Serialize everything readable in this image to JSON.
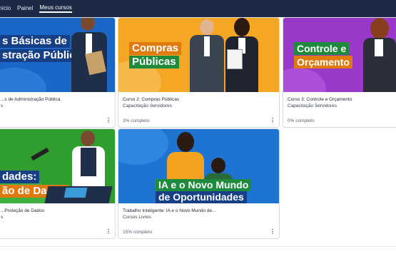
{
  "nav": {
    "items": [
      {
        "label": "Início",
        "active": false
      },
      {
        "label": "Painel",
        "active": false
      },
      {
        "label": "Meus cursos",
        "active": true
      }
    ]
  },
  "courses": [
    {
      "banner_lines": [
        "s Básicas de",
        "stração Pública"
      ],
      "title": "...s de Administração Pública",
      "category": "s",
      "progress": "",
      "color": "#1b67c8"
    },
    {
      "banner_lines": [
        "Compras",
        "Públicas"
      ],
      "title": "Curso 2: Compras Públicas",
      "category": "Capacitação Servidores",
      "progress": "3% completo",
      "color": "#f5a623"
    },
    {
      "banner_lines": [
        "Controle e",
        "Orçamento"
      ],
      "title": "Curso 3: Controle e Orçamento",
      "category": "Capacitação Servidores",
      "progress": "0% completo",
      "color": "#9a38c9"
    },
    {
      "banner_lines": [
        "dades:",
        "ão de Dados"
      ],
      "title": "...Proteção de Dados",
      "category": "s",
      "progress": "",
      "color": "#2f9e2f"
    },
    {
      "banner_lines": [
        "IA e o Novo Mundo",
        "de Oportunidades"
      ],
      "title": "Trabalho Inteligente: IA e o Novo Mundo de...",
      "category": "Cursos Livres",
      "progress": "15% completo",
      "color": "#1f74d1"
    }
  ],
  "more_glyph": "⋮"
}
